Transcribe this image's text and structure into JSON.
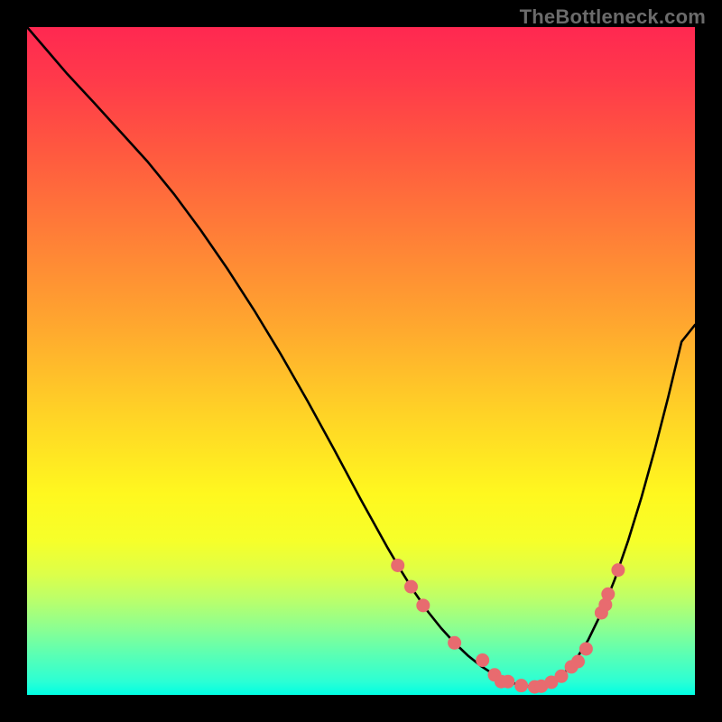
{
  "watermark": "TheBottleneck.com",
  "chart_data": {
    "type": "line",
    "title": "",
    "xlabel": "",
    "ylabel": "",
    "xlim": [
      0,
      100
    ],
    "ylim": [
      0,
      100
    ],
    "grid": false,
    "series": [
      {
        "name": "curve",
        "color": "#000000",
        "x": [
          0,
          3,
          6,
          10,
          14,
          18,
          22,
          26,
          30,
          34,
          38,
          42,
          46,
          50,
          54,
          56,
          58,
          60,
          62,
          64,
          66,
          68,
          70,
          72,
          74,
          76,
          78,
          80,
          82,
          84,
          86,
          88,
          90,
          92,
          94,
          96,
          98,
          100
        ],
        "y": [
          100,
          96.5,
          93,
          88.7,
          84.3,
          79.9,
          75.0,
          69.6,
          63.8,
          57.6,
          51.0,
          44.0,
          36.7,
          29.2,
          22.0,
          18.6,
          15.4,
          12.5,
          10.0,
          7.8,
          5.9,
          4.3,
          3.0,
          2.0,
          1.4,
          1.2,
          1.6,
          2.8,
          5.0,
          8.2,
          12.3,
          17.3,
          23.1,
          29.6,
          36.8,
          44.6,
          52.9,
          55.4
        ]
      },
      {
        "name": "markers",
        "color": "#e86b6f",
        "x": [
          55.5,
          57.5,
          59.3,
          64.0,
          68.2,
          70.0,
          71.0,
          72.0,
          74.0,
          76.0,
          77.0,
          78.5,
          80.0,
          81.5,
          82.5,
          83.7,
          86.0,
          86.6,
          87.0,
          88.5
        ],
        "y": [
          19.4,
          16.2,
          13.4,
          7.8,
          5.2,
          3.0,
          2.0,
          2.0,
          1.4,
          1.2,
          1.3,
          1.9,
          2.8,
          4.2,
          5.0,
          6.9,
          12.3,
          13.5,
          15.1,
          18.7
        ]
      }
    ],
    "background_gradient": {
      "top": "#ff2851",
      "mid": "#fff81f",
      "bottom": "#00ffe4"
    }
  }
}
